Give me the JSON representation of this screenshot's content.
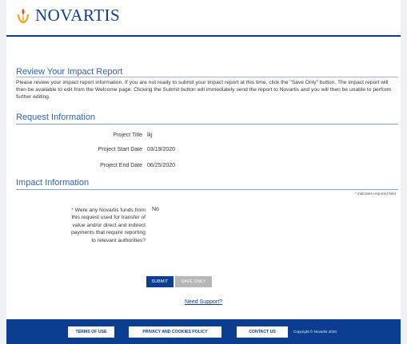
{
  "brand": {
    "name": "NOVARTIS",
    "color": "#0b3d91"
  },
  "review": {
    "title": "Review Your Impact Report",
    "instructions": "Please review your impact report information. If you are not ready to submit your impact report at this time, click the \"Save Only\" button. The impact report will then be available to edit from the Welcome page. Clicking the Submit button will immediately send the report to Novartis and you will then be unable to perform further editing."
  },
  "request_info": {
    "title": "Request Information",
    "fields": [
      {
        "label": "Project Title",
        "value": "lkj"
      },
      {
        "label": "Project Start Date",
        "value": "03/19/2020"
      },
      {
        "label": "Project End Date",
        "value": "06/25/2020"
      }
    ]
  },
  "impact_info": {
    "title": "Impact Information",
    "required_note": "indicates required field",
    "question": "Were any Novartis funds from this request used for transfer of value and/or direct and indirect payments that require reporting to relevant authorities?",
    "answer": "No"
  },
  "actions": {
    "submit": "SUBMIT",
    "save_only": "SAVE ONLY"
  },
  "support_link": "Need Support?",
  "footer": {
    "terms": "TERMS OF USE",
    "privacy": "PRIVACY AND COOKIES POLICY",
    "contact": "CONTACT US",
    "copyright": "Copyright © Novartis 2020"
  }
}
